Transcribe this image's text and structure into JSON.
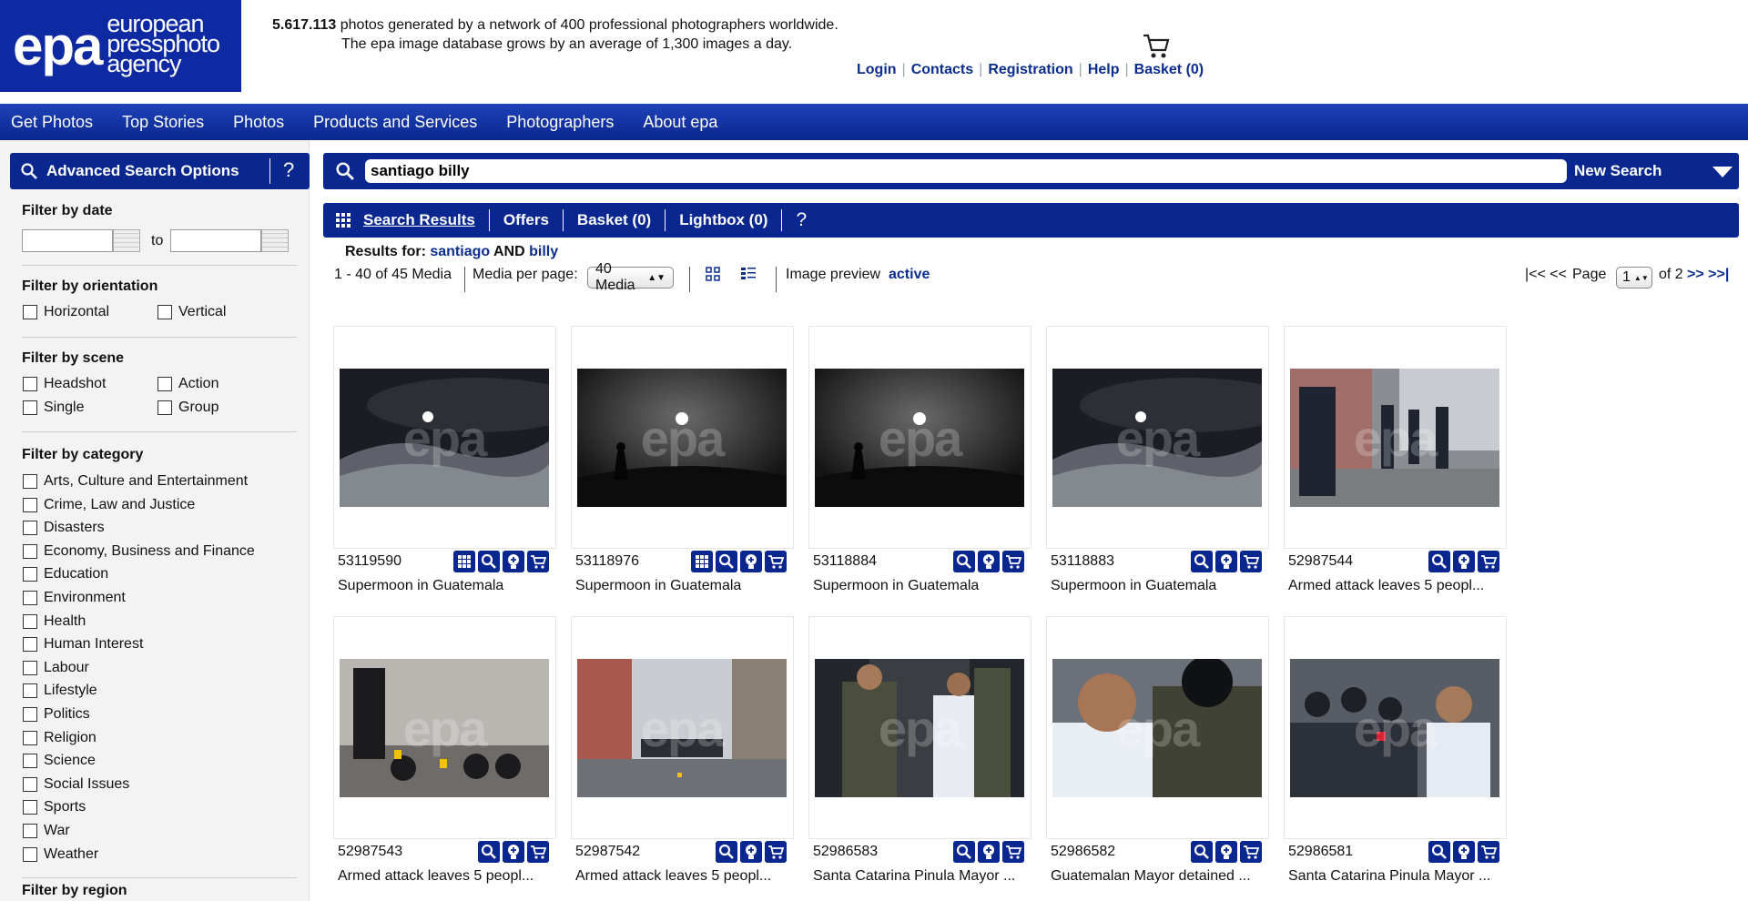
{
  "header": {
    "logo_main": "epa",
    "logo_lines": [
      "european",
      "pressphoto",
      "agency"
    ],
    "stats_number": "5.617.113",
    "stats_text": " photos generated by a network of 400 professional photographers worldwide.",
    "stats_line2": "The epa image database grows by an average of 1,300 images a day.",
    "links": [
      "Login",
      "Contacts",
      "Registration",
      "Help",
      "Basket (0)"
    ]
  },
  "nav": [
    "Get Photos",
    "Top Stories",
    "Photos",
    "Products and Services",
    "Photographers",
    "About epa"
  ],
  "sidebar": {
    "adv_label": "Advanced Search Options",
    "adv_help": "?",
    "date_title": "Filter by date",
    "date_to": "to",
    "orientation_title": "Filter by orientation",
    "orientation": [
      "Horizontal",
      "Vertical"
    ],
    "scene_title": "Filter by scene",
    "scene": [
      "Headshot",
      "Action",
      "Single",
      "Group"
    ],
    "category_title": "Filter by category",
    "categories": [
      "Arts, Culture and Entertainment",
      "Crime, Law and Justice",
      "Disasters",
      "Economy, Business and Finance",
      "Education",
      "Environment",
      "Health",
      "Human Interest",
      "Labour",
      "Lifestyle",
      "Politics",
      "Religion",
      "Science",
      "Social Issues",
      "Sports",
      "War",
      "Weather"
    ],
    "region_title": "Filter by region"
  },
  "search": {
    "value": "santiago billy",
    "new_search": "New Search"
  },
  "tabs": {
    "items": [
      "Search Results",
      "Offers",
      "Basket (0)",
      "Lightbox (0)"
    ],
    "help": "?"
  },
  "results": {
    "prefix": "Results for: ",
    "term1": "santiago",
    "op": " AND ",
    "term2": "billy",
    "range": "1 - 40 of 45 Media",
    "per_page_label": "Media per page:",
    "per_page_value": "40 Media",
    "preview_label": "Image preview",
    "preview_state": "active",
    "page_first": "|<< <<",
    "page_label": "Page",
    "page_value": "1",
    "page_of": "of 2",
    "page_next": ">> >>|"
  },
  "photos": [
    {
      "id": "53119590",
      "caption": "Supermoon in Guatemala",
      "scene": "moon-mist",
      "actions": [
        "grid",
        "zoom",
        "lightbox",
        "cart"
      ]
    },
    {
      "id": "53118976",
      "caption": "Supermoon in Guatemala",
      "scene": "moon-silhouette",
      "actions": [
        "grid",
        "zoom",
        "lightbox",
        "cart"
      ]
    },
    {
      "id": "53118884",
      "caption": "Supermoon in Guatemala",
      "scene": "moon-silhouette",
      "actions": [
        "zoom",
        "lightbox",
        "cart"
      ]
    },
    {
      "id": "53118883",
      "caption": "Supermoon in Guatemala",
      "scene": "moon-mist",
      "actions": [
        "zoom",
        "lightbox",
        "cart"
      ]
    },
    {
      "id": "52987544",
      "caption": "Armed attack leaves 5 peopl...",
      "scene": "street-police",
      "actions": [
        "zoom",
        "lightbox",
        "cart"
      ]
    },
    {
      "id": "52987543",
      "caption": "Armed attack leaves 5 peopl...",
      "scene": "motorbikes",
      "actions": [
        "zoom",
        "lightbox",
        "cart"
      ]
    },
    {
      "id": "52987542",
      "caption": "Armed attack leaves 5 peopl...",
      "scene": "street-wide",
      "actions": [
        "zoom",
        "lightbox",
        "cart"
      ]
    },
    {
      "id": "52986583",
      "caption": "Santa Catarina Pinula Mayor ...",
      "scene": "arrest",
      "actions": [
        "zoom",
        "lightbox",
        "cart"
      ]
    },
    {
      "id": "52986582",
      "caption": "Guatemalan Mayor detained ...",
      "scene": "closeup",
      "actions": [
        "zoom",
        "lightbox",
        "cart"
      ]
    },
    {
      "id": "52986581",
      "caption": "Santa Catarina Pinula Mayor ...",
      "scene": "press",
      "actions": [
        "zoom",
        "lightbox",
        "cart"
      ]
    }
  ],
  "colors": {
    "brand": "#0e2aa3",
    "nav": "#0a2790",
    "link": "#0b2d8f"
  }
}
